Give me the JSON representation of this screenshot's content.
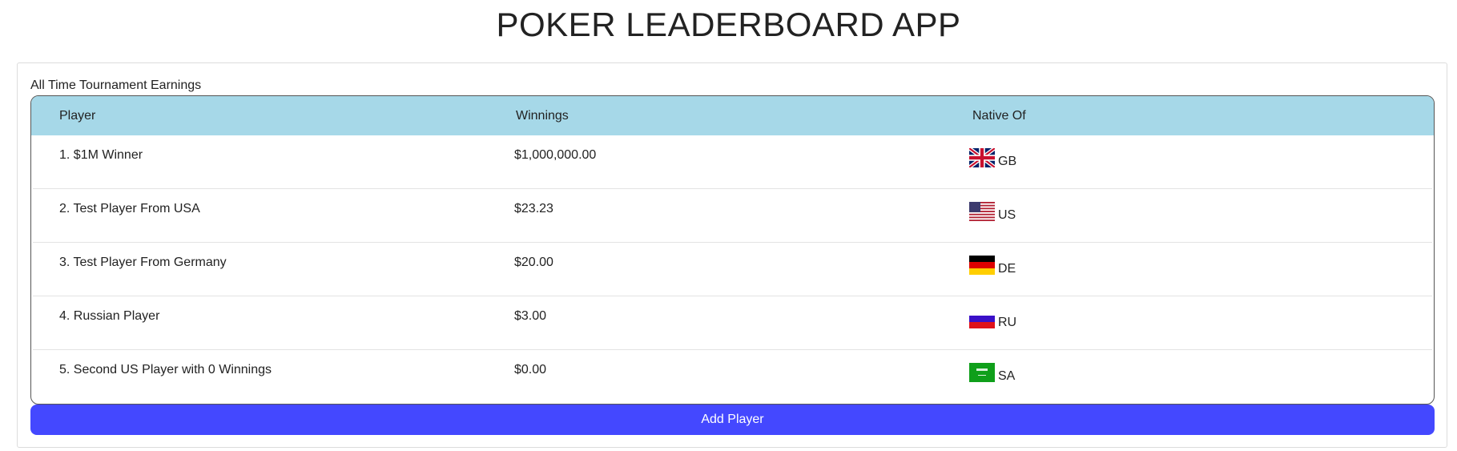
{
  "app": {
    "title": "POKER LEADERBOARD APP"
  },
  "leaderboard": {
    "caption": "All Time Tournament Earnings",
    "columns": {
      "player": "Player",
      "winnings": "Winnings",
      "native": "Native Of"
    },
    "rows": [
      {
        "player": "1. $1M Winner",
        "winnings": "$1,000,000.00",
        "country": "GB",
        "flag_icon": "gb-flag-icon"
      },
      {
        "player": "2. Test Player From USA",
        "winnings": "$23.23",
        "country": "US",
        "flag_icon": "us-flag-icon"
      },
      {
        "player": "3. Test Player From Germany",
        "winnings": "$20.00",
        "country": "DE",
        "flag_icon": "de-flag-icon"
      },
      {
        "player": "4. Russian Player",
        "winnings": "$3.00",
        "country": "RU",
        "flag_icon": "ru-flag-icon"
      },
      {
        "player": "5. Second US Player with 0 Winnings",
        "winnings": "$0.00",
        "country": "SA",
        "flag_icon": "sa-flag-icon"
      }
    ],
    "add_button_label": "Add Player"
  },
  "colors": {
    "header_bg": "#a6d8e8",
    "button_bg": "#4448ff",
    "button_text": "#ffffff"
  }
}
